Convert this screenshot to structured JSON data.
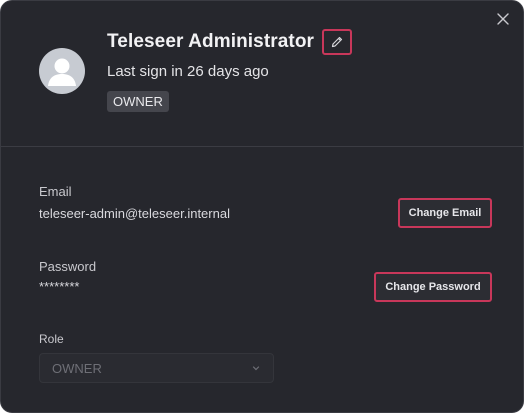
{
  "profile": {
    "name": "Teleseer Administrator",
    "last_signin": "Last sign in 26 days ago",
    "role_badge": "OWNER"
  },
  "email": {
    "label": "Email",
    "value": "teleseer-admin@teleseer.internal",
    "button_label": "Change Email"
  },
  "password": {
    "label": "Password",
    "value": "********",
    "button_label": "Change Password"
  },
  "role": {
    "label": "Role",
    "selected": "OWNER"
  },
  "icons": {
    "close": "close-icon",
    "edit": "pencil-icon",
    "avatar": "user-icon",
    "dropdown": "chevron-down-icon"
  },
  "colors": {
    "dialog_bg": "#26272d",
    "highlight": "#c8375a",
    "badge_bg": "#45464d"
  }
}
